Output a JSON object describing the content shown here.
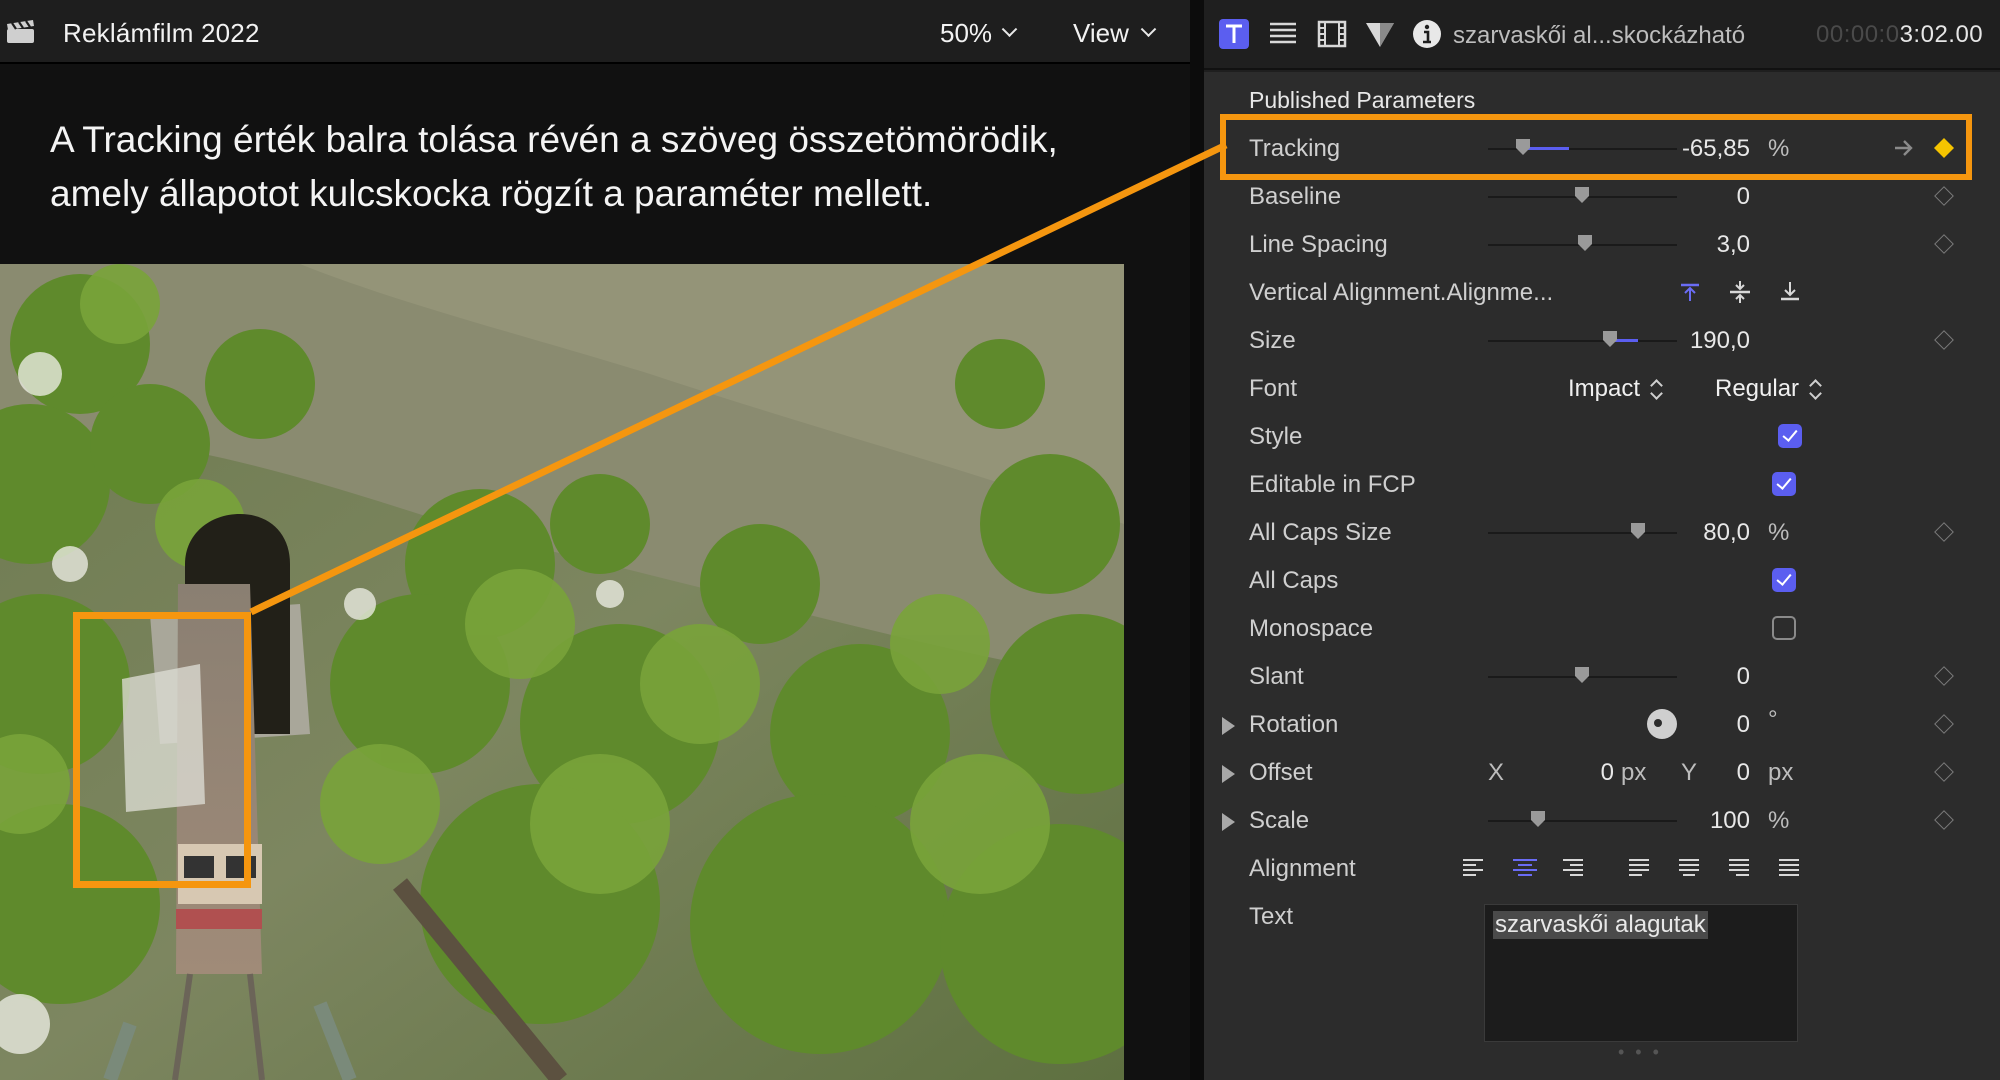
{
  "viewer": {
    "title": "Reklámfilm 2022",
    "zoom": "50%",
    "view_menu": "View",
    "caption_line1": "A Tracking érték balra tolása révén a szöveg összetömörödik,",
    "caption_line2": "amely állapotot kulcskocka rögzít a paraméter mellett."
  },
  "inspector": {
    "clip_name": "szarvaskői al...skockázható",
    "timecode_dim": "00:00:0",
    "timecode_lit": "3:02.00",
    "section_title": "Published Parameters",
    "params": {
      "tracking": {
        "label": "Tracking",
        "value": "-65,85",
        "unit": "%"
      },
      "baseline": {
        "label": "Baseline",
        "value": "0"
      },
      "line_spacing": {
        "label": "Line Spacing",
        "value": "3,0"
      },
      "vertical_alignment": {
        "label": "Vertical Alignment.Alignme..."
      },
      "size": {
        "label": "Size",
        "value": "190,0"
      },
      "font": {
        "label": "Font",
        "family": "Impact",
        "style": "Regular"
      },
      "style": {
        "label": "Style",
        "checked": true
      },
      "editable": {
        "label": "Editable in FCP",
        "checked": true
      },
      "all_caps_size": {
        "label": "All Caps Size",
        "value": "80,0",
        "unit": "%"
      },
      "all_caps": {
        "label": "All Caps",
        "checked": true
      },
      "monospace": {
        "label": "Monospace",
        "checked": false
      },
      "slant": {
        "label": "Slant",
        "value": "0"
      },
      "rotation": {
        "label": "Rotation",
        "value": "0",
        "unit": "°"
      },
      "offset": {
        "label": "Offset",
        "x_label": "X",
        "x_value": "0",
        "x_unit": "px",
        "y_label": "Y",
        "y_value": "0",
        "y_unit": "px"
      },
      "scale": {
        "label": "Scale",
        "value": "100",
        "unit": "%"
      },
      "alignment": {
        "label": "Alignment"
      },
      "text": {
        "label": "Text",
        "value": "szarvaskői alagutak"
      }
    }
  },
  "colors": {
    "accent": "#5b5ef0",
    "highlight": "#f5960f",
    "keyframe_set": "#f5c400"
  },
  "icons": [
    "clapperboard-icon",
    "chevron-down-icon",
    "text-inspector-icon",
    "paragraph-icon",
    "film-icon",
    "filter-icon",
    "info-icon",
    "keyframe-icon",
    "keyframe-arrow-icon"
  ]
}
